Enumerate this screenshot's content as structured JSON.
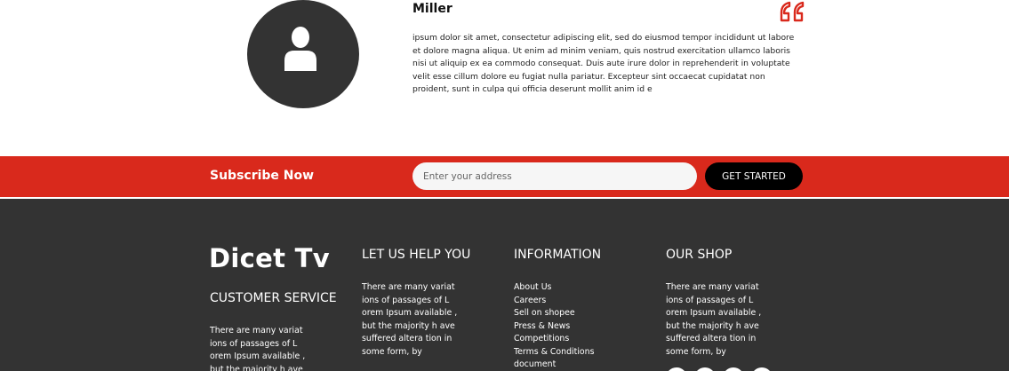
{
  "testimonial": {
    "avatar_icon": "user-icon",
    "name": "Miller",
    "quote_icon": "quote-icon",
    "text": "ipsum dolor sit amet, consectetur adipiscing elit, sed do eiusmod tempor incididunt ut labore et dolore magna aliqua. Ut enim ad minim veniam, quis nostrud exercitation ullamco laboris nisi ut aliquip ex ea commodo consequat. Duis aute irure dolor in reprehenderit in voluptate velit esse cillum dolore eu fugiat nulla pariatur. Excepteur sint occaecat cupidatat non proident, sunt in culpa qui officia deserunt mollit anim id e"
  },
  "subscribe": {
    "title": "Subscribe Now",
    "placeholder": "Enter your address",
    "button_label": "GET STARTED"
  },
  "footer": {
    "brand": "Dicet Tv",
    "customer_service": {
      "title": "CUSTOMER SERVICE",
      "text": "There are many variat ions of passages of L orem Ipsum available , but the majority h ave"
    },
    "help": {
      "title": "LET US HELP YOU",
      "text": "There are many variat ions of passages of L orem Ipsum available , but the majority h ave suffered altera tion in some form, by"
    },
    "information": {
      "title": "INFORMATION",
      "links": [
        "About Us",
        "Careers",
        "Sell on shopee",
        "Press & News",
        "Competitions",
        "Terms & Conditions",
        "document"
      ]
    },
    "shop": {
      "title": "OUR SHOP",
      "text": "There are many variat ions of passages of L orem Ipsum available , but the majority h ave suffered altera tion in some form, by"
    }
  },
  "colors": {
    "accent": "#d9291c",
    "footer_bg": "#333333",
    "avatar_bg": "#333333"
  }
}
